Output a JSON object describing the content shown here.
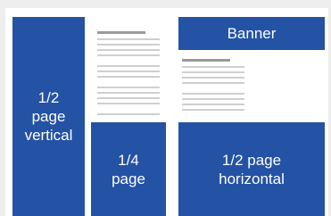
{
  "blocks": {
    "half_vertical": "1/2\npage\nvertical",
    "quarter": "1/4\npage",
    "half_horizontal": "1/2 page\nhorizontal",
    "banner": "Banner"
  },
  "colors": {
    "ad_block": "#2452a4",
    "page_bg": "#eeeeee",
    "sheet_bg": "#ffffff",
    "text_line": "#cfcfcf",
    "heading_line": "#9a9a9a"
  }
}
